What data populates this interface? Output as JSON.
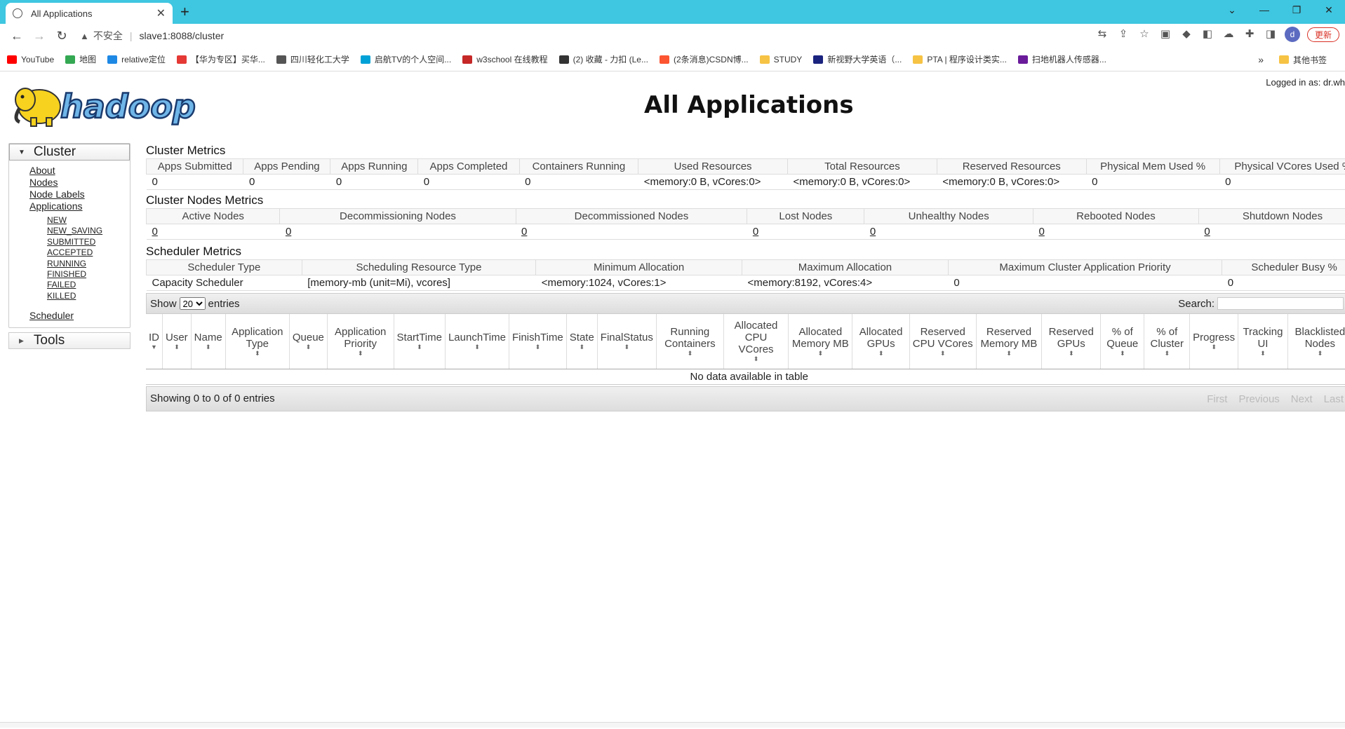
{
  "browser": {
    "tab_title": "All Applications",
    "new_tab": "+",
    "security_label": "不安全",
    "url": "slave1:8088/cluster",
    "update_label": "更新",
    "avatar_letter": "d",
    "bookmarks": [
      {
        "label": "YouTube",
        "color": "#ff0000"
      },
      {
        "label": "地图",
        "color": "#34a853"
      },
      {
        "label": "relative定位",
        "color": "#1e88e5"
      },
      {
        "label": "【华为专区】买华...",
        "color": "#e53935"
      },
      {
        "label": "四川轻化工大学",
        "color": "#555555"
      },
      {
        "label": "启航TV的个人空间...",
        "color": "#00a1d6"
      },
      {
        "label": "w3school 在线教程",
        "color": "#c62828"
      },
      {
        "label": "(2) 收藏 - 力扣 (Le...",
        "color": "#333333"
      },
      {
        "label": "(2条消息)CSDN博...",
        "color": "#fc5531"
      },
      {
        "label": "STUDY",
        "color": "#f6c344"
      },
      {
        "label": "新视野大学英语（...",
        "color": "#1a237e"
      },
      {
        "label": "PTA | 程序设计类实...",
        "color": "#f6c344"
      },
      {
        "label": "扫地机器人传感器...",
        "color": "#6a1b9a"
      }
    ],
    "more_bookmarks": "»",
    "other_bookmarks": "其他书签"
  },
  "header": {
    "page_title": "All Applications",
    "logged_in": "Logged in as: dr.wh"
  },
  "sidebar": {
    "cluster_label": "Cluster",
    "links": [
      "About",
      "Nodes",
      "Node Labels",
      "Applications"
    ],
    "app_states": [
      "NEW",
      "NEW_SAVING",
      "SUBMITTED",
      "ACCEPTED",
      "RUNNING",
      "FINISHED",
      "FAILED",
      "KILLED"
    ],
    "scheduler": "Scheduler",
    "tools_label": "Tools"
  },
  "cluster_metrics": {
    "title": "Cluster Metrics",
    "headers": [
      "Apps Submitted",
      "Apps Pending",
      "Apps Running",
      "Apps Completed",
      "Containers Running",
      "Used Resources",
      "Total Resources",
      "Reserved Resources",
      "Physical Mem Used %",
      "Physical VCores Used %"
    ],
    "values": [
      "0",
      "0",
      "0",
      "0",
      "0",
      "<memory:0 B, vCores:0>",
      "<memory:0 B, vCores:0>",
      "<memory:0 B, vCores:0>",
      "0",
      "0"
    ]
  },
  "node_metrics": {
    "title": "Cluster Nodes Metrics",
    "headers": [
      "Active Nodes",
      "Decommissioning Nodes",
      "Decommissioned Nodes",
      "Lost Nodes",
      "Unhealthy Nodes",
      "Rebooted Nodes",
      "Shutdown Nodes"
    ],
    "values": [
      "0",
      "0",
      "0",
      "0",
      "0",
      "0",
      "0"
    ]
  },
  "scheduler_metrics": {
    "title": "Scheduler Metrics",
    "headers": [
      "Scheduler Type",
      "Scheduling Resource Type",
      "Minimum Allocation",
      "Maximum Allocation",
      "Maximum Cluster Application Priority",
      "Scheduler Busy %"
    ],
    "values": [
      "Capacity Scheduler",
      "[memory-mb (unit=Mi), vcores]",
      "<memory:1024, vCores:1>",
      "<memory:8192, vCores:4>",
      "0",
      "0"
    ]
  },
  "apps_table": {
    "show_label": "Show",
    "entries_value": "20",
    "entries_label": "entries",
    "search_label": "Search:",
    "columns": [
      "ID",
      "User",
      "Name",
      "Application Type",
      "Queue",
      "Application Priority",
      "StartTime",
      "LaunchTime",
      "FinishTime",
      "State",
      "FinalStatus",
      "Running Containers",
      "Allocated CPU VCores",
      "Allocated Memory MB",
      "Allocated GPUs",
      "Reserved CPU VCores",
      "Reserved Memory MB",
      "Reserved GPUs",
      "% of Queue",
      "% of Cluster",
      "Progress",
      "Tracking UI",
      "Blacklisted Nodes"
    ],
    "empty_text": "No data available in table",
    "info_text": "Showing 0 to 0 of 0 entries",
    "pager": [
      "First",
      "Previous",
      "Next",
      "Last"
    ]
  }
}
